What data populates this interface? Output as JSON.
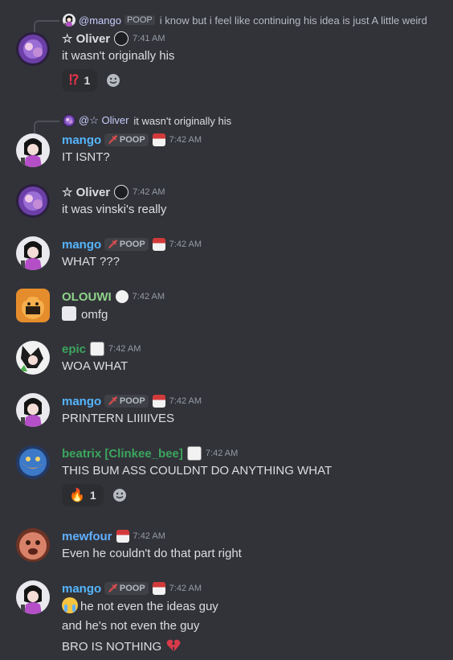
{
  "colors": {
    "background": "#323339",
    "mango": "#55b6ff",
    "oliver": "#dbdee1",
    "olouwi": "#8fd38a",
    "epic": "#3ba55d",
    "beatrix": "#3ba55d",
    "mewfour": "#5fb0ff",
    "timestamp": "#949ba4"
  },
  "messages": [
    {
      "reply": {
        "author": "@mango",
        "tag": "POOP",
        "text": "i know but i feel like continuing his idea is just   A little weird"
      },
      "author": "☆ Oliver",
      "time": "7:41 AM",
      "lines": [
        "it wasn't originally his"
      ],
      "reaction": {
        "emoji": "⁉",
        "count": "1"
      }
    },
    {
      "reply": {
        "author": "@☆ Oliver",
        "tag": "",
        "text": "it wasn't originally his"
      },
      "author": "mango",
      "tag": "POOP",
      "time": "7:42 AM",
      "lines": [
        "IT ISNT?"
      ]
    },
    {
      "author": "☆ Oliver",
      "time": "7:42 AM",
      "lines": [
        "it was vinski's really"
      ]
    },
    {
      "author": "mango",
      "tag": "POOP",
      "time": "7:42 AM",
      "lines": [
        "WHAT ???"
      ]
    },
    {
      "author": "OLOUWI",
      "time": "7:42 AM",
      "lines": [
        "omfg"
      ]
    },
    {
      "author": "epic",
      "time": "7:42 AM",
      "lines": [
        "WOA WHAT"
      ]
    },
    {
      "author": "mango",
      "tag": "POOP",
      "time": "7:42 AM",
      "lines": [
        "PRINTERN LIIIIIVES"
      ]
    },
    {
      "author": "beatrix [Clinkee_bee]",
      "time": "7:42 AM",
      "lines": [
        "THIS BUM ASS COULDNT DO ANYTHING WHAT"
      ],
      "reaction": {
        "emoji": "🔥",
        "count": "1"
      }
    },
    {
      "author": "mewfour",
      "time": "7:42 AM",
      "lines": [
        "Even he couldn't do that part right"
      ]
    },
    {
      "author": "mango",
      "tag": "POOP",
      "time": "7:42 AM",
      "lines": [
        "he not even the ideas guy",
        "and he's not even the guy",
        "BRO IS NOTHING"
      ]
    }
  ]
}
